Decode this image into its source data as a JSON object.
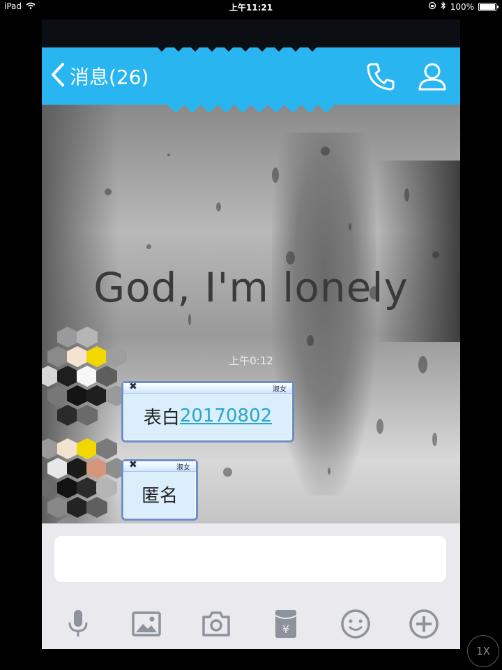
{
  "status_bar": {
    "device": "iPad",
    "time": "上午11:21",
    "battery": "100%",
    "battery_level": 1.0
  },
  "header": {
    "back_label": "消息(26)"
  },
  "chat": {
    "background_text": "God, I'm lonely",
    "timestamp": "上午0:12",
    "messages": [
      {
        "tag": "淑女",
        "text_plain": "表白",
        "text_link": "20170802"
      },
      {
        "tag": "淑女",
        "text_plain": "匿名"
      }
    ]
  },
  "toolbar_icons": [
    "microphone-icon",
    "image-icon",
    "camera-icon",
    "red-packet-icon",
    "emoji-icon",
    "plus-icon"
  ],
  "speed_label": "1X",
  "colors": {
    "header": "#29b6f0",
    "bubble_border": "#6c8fc8",
    "link": "#2aa6c8"
  }
}
